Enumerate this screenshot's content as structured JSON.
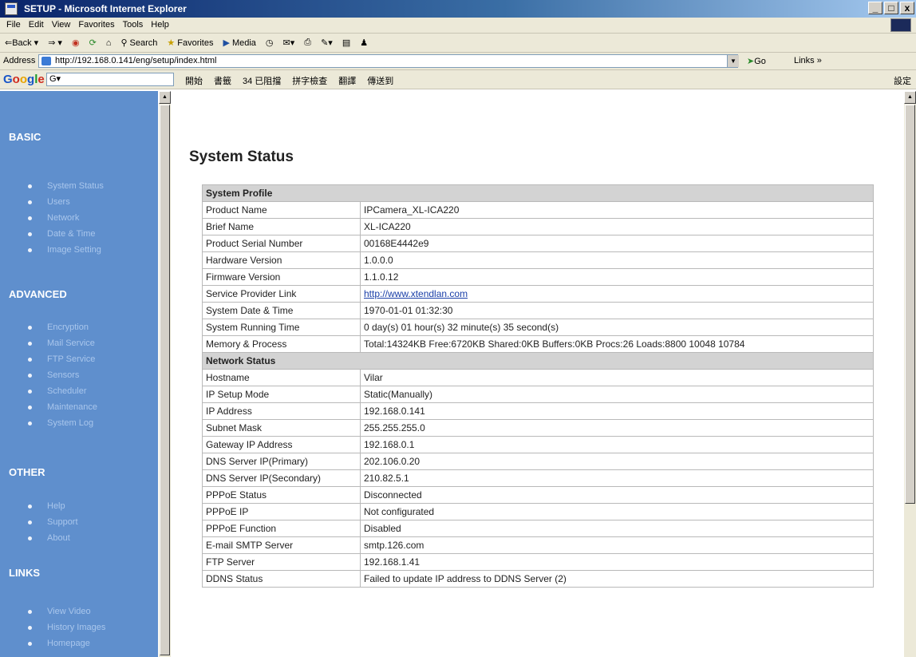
{
  "window": {
    "title": "SETUP - Microsoft Internet Explorer",
    "controls": [
      "_",
      "□",
      "x"
    ]
  },
  "menu": [
    "File",
    "Edit",
    "View",
    "Favorites",
    "Tools",
    "Help"
  ],
  "toolbar": {
    "back": "⇐Back",
    "forward": "⇒",
    "search": "Search",
    "favorites": "Favorites",
    "media": "Media"
  },
  "address": {
    "label": "Address",
    "url": "http://192.168.0.141/eng/setup/index.html",
    "go": "Go",
    "links": "Links »"
  },
  "google_bar": {
    "logo": "Google",
    "search_prefix": "G▾",
    "items": [
      "開始",
      "書籤",
      "34 已阻擋",
      "拼字檢查",
      "翻譯",
      "傳送到"
    ],
    "settings": "設定"
  },
  "sidebar": {
    "sections": [
      {
        "title": "BASIC",
        "items": [
          "System Status",
          "Users",
          "Network",
          "Date & Time",
          "Image Setting"
        ]
      },
      {
        "title": "ADVANCED",
        "items": [
          "Encryption",
          "Mail Service",
          "FTP Service",
          "Sensors",
          "Scheduler",
          "Maintenance",
          "System Log"
        ]
      },
      {
        "title": "OTHER",
        "items": [
          "Help",
          "Support",
          "About"
        ]
      },
      {
        "title": "LINKS",
        "items": [
          "View Video",
          "History Images",
          "Homepage"
        ]
      }
    ]
  },
  "main": {
    "title": "System Status",
    "profile": {
      "header": "System Profile",
      "rows": [
        [
          "Product Name",
          "IPCamera_XL-ICA220"
        ],
        [
          "Brief Name",
          "XL-ICA220"
        ],
        [
          "Product Serial Number",
          "00168E4442e9"
        ],
        [
          "Hardware Version",
          "1.0.0.0"
        ],
        [
          "Firmware Version",
          "1.1.0.12"
        ],
        [
          "Service Provider Link",
          "http://www.xtendlan.com"
        ],
        [
          "System Date & Time",
          "1970-01-01 01:32:30"
        ],
        [
          "System Running Time",
          "0 day(s) 01 hour(s) 32 minute(s) 35 second(s)"
        ],
        [
          "Memory & Process",
          "Total:14324KB Free:6720KB Shared:0KB Buffers:0KB Procs:26 Loads:8800 10048 10784"
        ]
      ]
    },
    "network": {
      "header": "Network Status",
      "rows": [
        [
          "Hostname",
          "Vilar"
        ],
        [
          "IP Setup Mode",
          "Static(Manually)"
        ],
        [
          "IP Address",
          "192.168.0.141"
        ],
        [
          "Subnet Mask",
          "255.255.255.0"
        ],
        [
          "Gateway IP Address",
          "192.168.0.1"
        ],
        [
          "DNS Server IP(Primary)",
          "202.106.0.20"
        ],
        [
          "DNS Server IP(Secondary)",
          "210.82.5.1"
        ],
        [
          "PPPoE Status",
          "Disconnected"
        ],
        [
          "PPPoE IP",
          "Not configurated"
        ],
        [
          "PPPoE Function",
          "Disabled"
        ],
        [
          "E-mail SMTP Server",
          "smtp.126.com"
        ],
        [
          "FTP Server",
          "192.168.1.41"
        ],
        [
          "DDNS Status",
          "Failed to update IP address to DDNS Server (2)"
        ]
      ]
    }
  }
}
